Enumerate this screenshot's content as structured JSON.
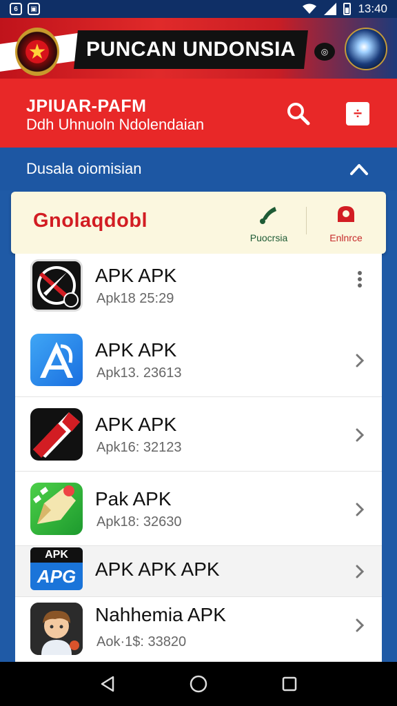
{
  "status_bar": {
    "time": "13:40"
  },
  "banner": {
    "title": "PUNCAN UNDONSIA"
  },
  "header": {
    "title": "JPIUAR-PAFM",
    "subtitle": "Ddh Uhnuoln Ndolendaian"
  },
  "section": {
    "title": "Dusala oiomisian"
  },
  "filter": {
    "label": "Gnolaqdobl",
    "actions": [
      {
        "label": "Puocrsia",
        "icon": "music-note-icon"
      },
      {
        "label": "Enlnrce",
        "icon": "alert-icon"
      }
    ]
  },
  "apps": [
    {
      "title": "APK APK",
      "subtitle": "Apk18  25:29",
      "icon": "compass-app-icon"
    },
    {
      "title": "APK APK",
      "subtitle": "Apk13. 23613",
      "icon": "appstore-icon"
    },
    {
      "title": "APK APK",
      "subtitle": "Apk16: 32123",
      "icon": "flag-app-icon"
    },
    {
      "title": "Pak APK",
      "subtitle": "Apk18: 32630",
      "icon": "pencil-app-icon"
    },
    {
      "title": "APK APK APK",
      "subtitle": "",
      "icon": "apk-badge-icon",
      "badge_top": "APK",
      "badge_bottom": "APG"
    },
    {
      "title": "Nahhemia APK",
      "subtitle": "Aok·1$: 33820",
      "icon": "avatar-app-icon"
    }
  ],
  "colors": {
    "header_red": "#e82828",
    "section_blue": "#1d57a3",
    "filter_bg": "#fbf7df",
    "filter_text": "#d21d23"
  }
}
